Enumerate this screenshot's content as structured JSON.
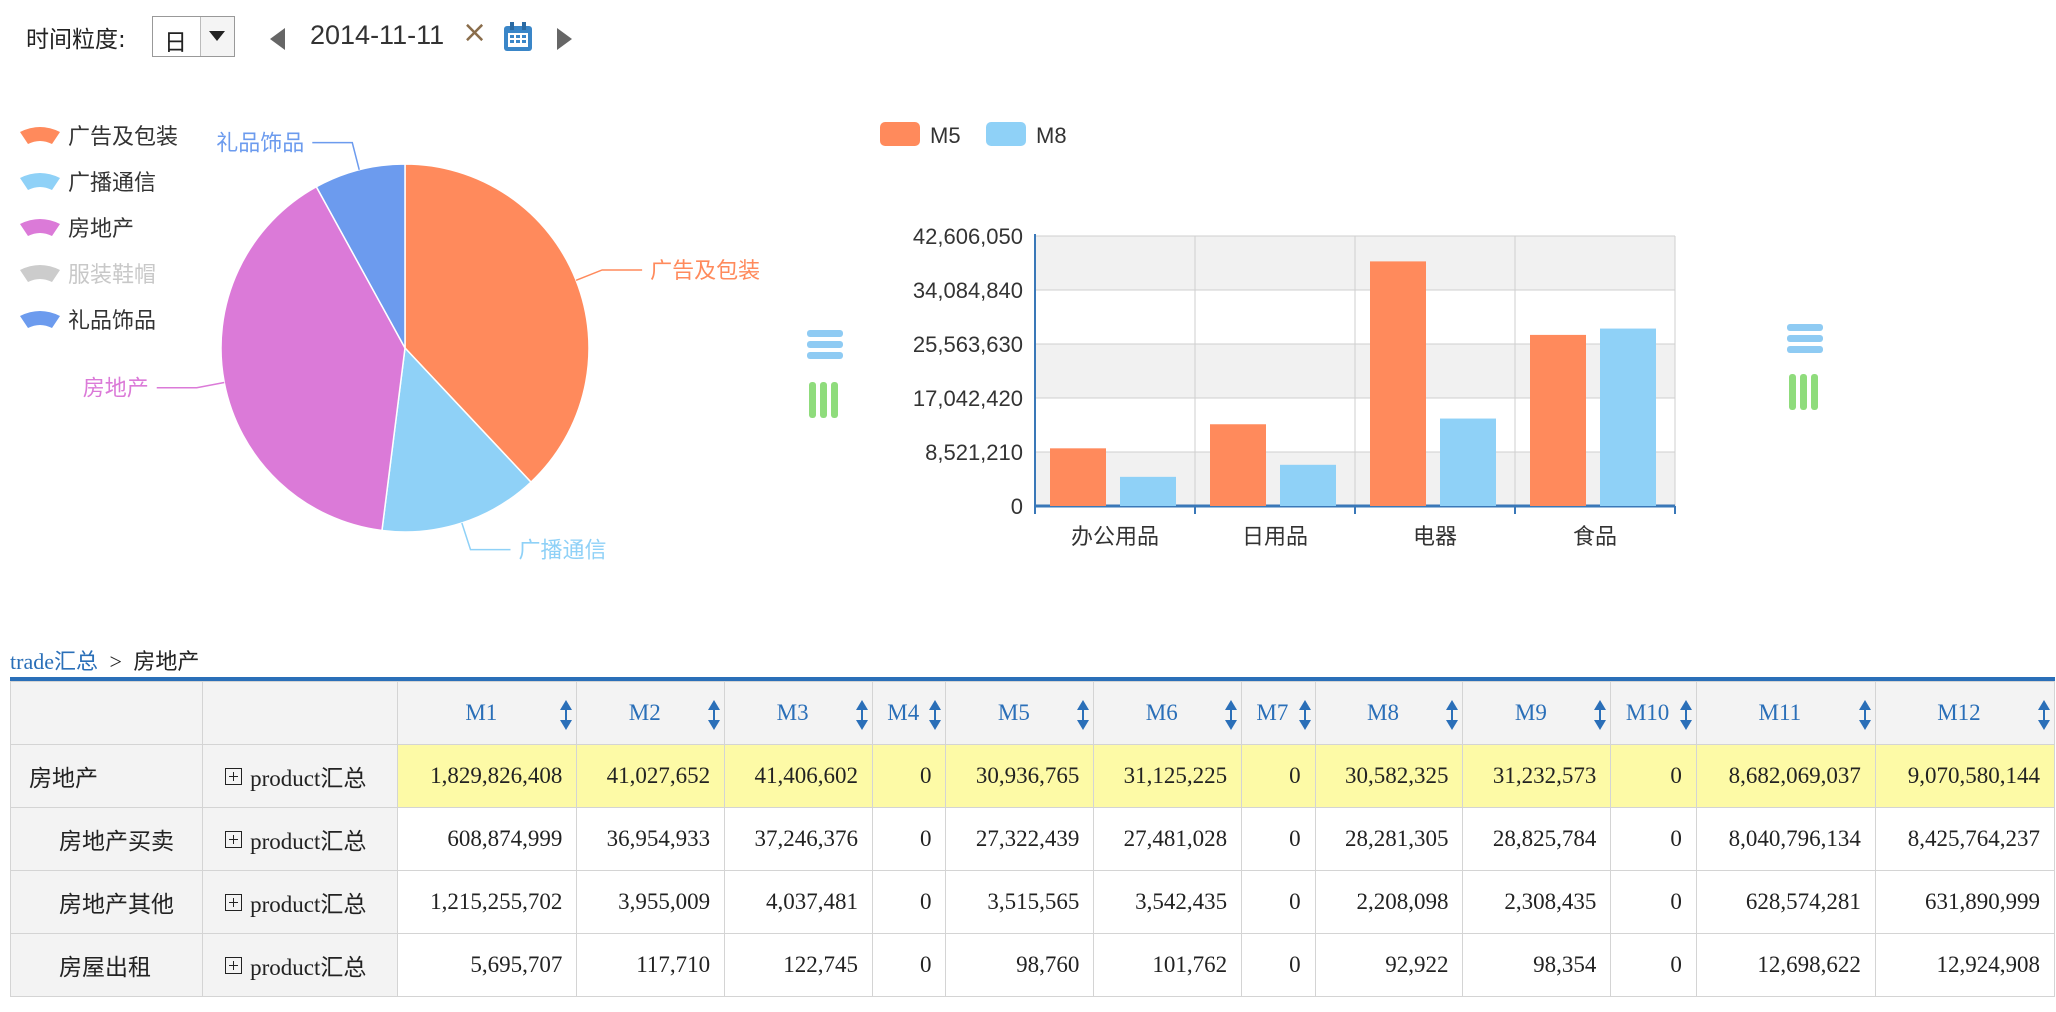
{
  "toolbar": {
    "granularity_label": "时间粒度:",
    "granularity_value": "日",
    "date": "2014-11-11",
    "clear_symbol": "×"
  },
  "icons": {
    "prev": "chevron-left-icon",
    "next": "chevron-right-icon",
    "calendar": "calendar-icon",
    "clear": "close-icon",
    "list_toggle": "list-icon",
    "column_toggle": "column-chart-icon"
  },
  "chart_data": [
    {
      "type": "pie",
      "legend_position": "left",
      "categories": [
        "广告及包装",
        "广播通信",
        "房地产",
        "服装鞋帽",
        "礼品饰品"
      ],
      "values": [
        38,
        14,
        40,
        0,
        8
      ],
      "colors": [
        "#ff8a5c",
        "#8fd1f7",
        "#db7ad8",
        "#cccccc",
        "#6c9bee"
      ],
      "legend_disabled": [
        false,
        false,
        false,
        true,
        false
      ],
      "slice_labels": [
        "广告及包装",
        "广播通信",
        "房地产",
        "礼品饰品"
      ]
    },
    {
      "type": "bar",
      "categories": [
        "办公用品",
        "日用品",
        "电器",
        "食品"
      ],
      "series": [
        {
          "name": "M5",
          "values": [
            9100000,
            12900000,
            38600000,
            27000000
          ],
          "color": "#ff8a5c"
        },
        {
          "name": "M8",
          "values": [
            4600000,
            6500000,
            13800000,
            28000000
          ],
          "color": "#8fd1f7"
        }
      ],
      "ylim": [
        0,
        42606050
      ],
      "yticks": [
        "0",
        "8,521,210",
        "17,042,420",
        "25,563,630",
        "34,084,840",
        "42,606,050"
      ],
      "legend_position": "top-left",
      "grid": true
    }
  ],
  "breadcrumb": {
    "root": "trade汇总",
    "separator": ">",
    "current": "房地产"
  },
  "table": {
    "headers": [
      "M1",
      "M2",
      "M3",
      "M4",
      "M5",
      "M6",
      "M7",
      "M8",
      "M9",
      "M10",
      "M11",
      "M12"
    ],
    "rows": [
      {
        "dim1": "房地产",
        "dim2": "product汇总",
        "values": [
          "1,829,826,408",
          "41,027,652",
          "41,406,602",
          "0",
          "30,936,765",
          "31,125,225",
          "0",
          "30,582,325",
          "31,232,573",
          "0",
          "8,682,069,037",
          "9,070,580,144"
        ]
      },
      {
        "dim1": "房地产买卖",
        "dim2": "product汇总",
        "values": [
          "608,874,999",
          "36,954,933",
          "37,246,376",
          "0",
          "27,322,439",
          "27,481,028",
          "0",
          "28,281,305",
          "28,825,784",
          "0",
          "8,040,796,134",
          "8,425,764,237"
        ]
      },
      {
        "dim1": "房地产其他",
        "dim2": "product汇总",
        "values": [
          "1,215,255,702",
          "3,955,009",
          "4,037,481",
          "0",
          "3,515,565",
          "3,542,435",
          "0",
          "2,208,098",
          "2,308,435",
          "0",
          "628,574,281",
          "631,890,999"
        ]
      },
      {
        "dim1": "房屋出租",
        "dim2": "product汇总",
        "values": [
          "5,695,707",
          "117,710",
          "122,745",
          "0",
          "98,760",
          "101,762",
          "0",
          "92,922",
          "98,354",
          "0",
          "12,698,622",
          "12,924,908"
        ]
      }
    ]
  }
}
